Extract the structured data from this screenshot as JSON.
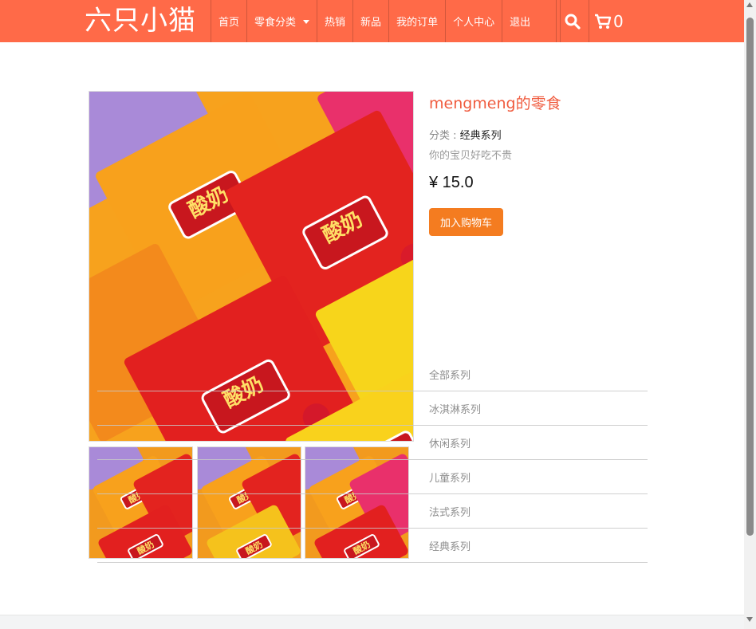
{
  "brand": "六只小猫",
  "nav": {
    "home": "首页",
    "snacks_menu": "零食分类",
    "hot": "热销",
    "new": "新品",
    "orders": "我的订单",
    "profile": "个人中心",
    "logout": "退出",
    "cart_count": "0"
  },
  "product": {
    "name": "mengmeng的零食",
    "category_label": "分类 : ",
    "category_value": "经典系列",
    "description": "你的宝贝好吃不贵",
    "price": "¥ 15.0",
    "add_to_cart": "加入购物车",
    "pack_logo_text": "酸奶"
  },
  "categories": [
    "全部系列",
    "冰淇淋系列",
    "休闲系列",
    "儿童系列",
    "法式系列",
    "经典系列"
  ],
  "colors": {
    "navbar": "#ff6a48",
    "accent_text": "#f05b3e",
    "button": "#f47c20"
  }
}
